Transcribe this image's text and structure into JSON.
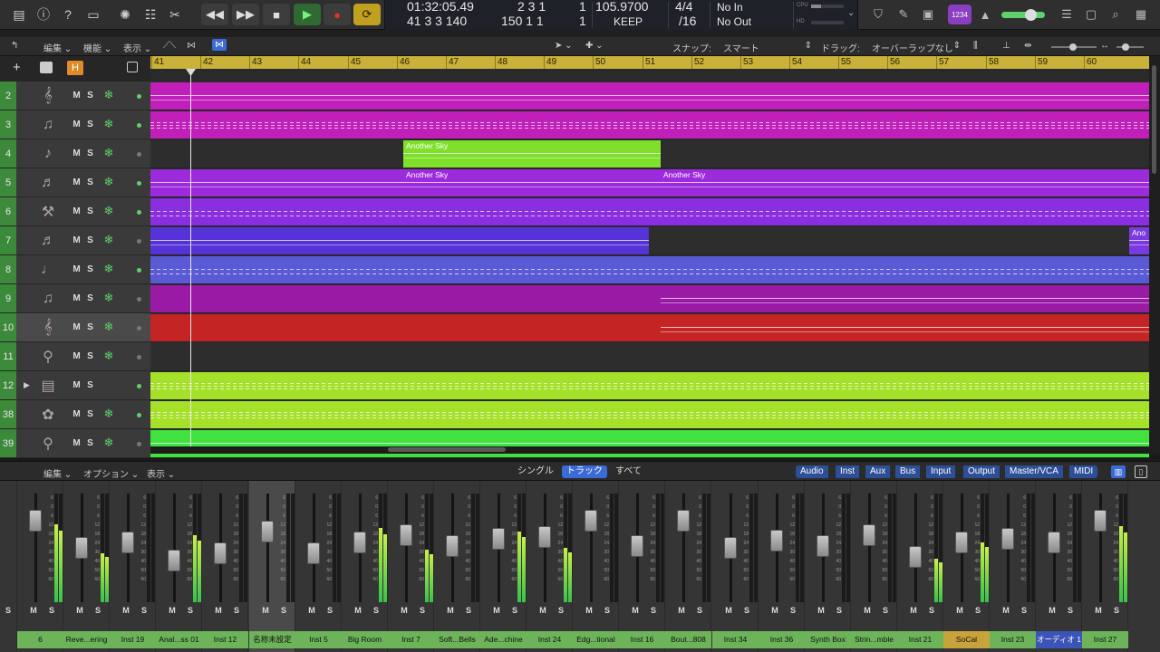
{
  "transport": {
    "time": "01:32:05.49",
    "beats": "2  3  1",
    "beats_tick": "1",
    "bars": "41  3  3  140",
    "bars2": "150  1  1",
    "bars2_tick": "1",
    "tempo": "105.9700",
    "tempo_mode": "KEEP",
    "sig": "4/4",
    "div": "/16",
    "in": "No In",
    "out": "No Out",
    "cpu_label": "CPU",
    "hd_label": "HD"
  },
  "tracks_menu": {
    "edit": "編集",
    "function": "機能",
    "view": "表示"
  },
  "snap": {
    "label": "スナップ:",
    "value": "スマート"
  },
  "drag": {
    "label": "ドラッグ:",
    "value": "オーバーラップなし"
  },
  "header": {
    "h": "H"
  },
  "ruler_bars": [
    "41",
    "42",
    "43",
    "44",
    "45",
    "46",
    "47",
    "48",
    "49",
    "50",
    "51",
    "52",
    "53",
    "54",
    "55",
    "56",
    "57",
    "58",
    "59",
    "60"
  ],
  "tracks": [
    {
      "num": "2",
      "icon": "violin-icon",
      "color": "#c01fba",
      "dot": "#5fd06a"
    },
    {
      "num": "3",
      "icon": "strings-icon",
      "color": "#c01fba",
      "dot": "#5fd06a"
    },
    {
      "num": "4",
      "icon": "horn-icon",
      "color": "#4a4a4a",
      "dot": "#777"
    },
    {
      "num": "5",
      "icon": "piano-icon",
      "color": "#9c2bdc",
      "dot": "#5fd06a"
    },
    {
      "num": "6",
      "icon": "mallet-icon",
      "color": "#8a2fe0",
      "dot": "#5fd06a"
    },
    {
      "num": "7",
      "icon": "piano-icon",
      "color": "#5533d6",
      "dot": "#777"
    },
    {
      "num": "8",
      "icon": "guitar-icon",
      "color": "#5a5ad6",
      "dot": "#5fd06a"
    },
    {
      "num": "9",
      "icon": "strings-icon",
      "color": "#9a1aa6",
      "dot": "#777"
    },
    {
      "num": "10",
      "icon": "violin-icon",
      "color": "#c42424",
      "dot": "#777"
    },
    {
      "num": "11",
      "icon": "drum-icon",
      "color": "#4a4a4a",
      "dot": "#777"
    },
    {
      "num": "12",
      "icon": "folder-icon",
      "color": "#a5e02a",
      "dot": "#5fd06a"
    },
    {
      "num": "38",
      "icon": "drum-kit-icon",
      "color": "#a5e02a",
      "dot": "#5fd06a"
    },
    {
      "num": "39",
      "icon": "drum-icon",
      "color": "#3fe23f",
      "dot": "#777"
    }
  ],
  "regions": {
    "r4": "Another Sky",
    "r5a": "Another Sky",
    "r5b": "Another Sky",
    "r7": "Ano"
  },
  "btn": {
    "m": "M",
    "s": "S"
  },
  "mixer_menu": {
    "edit": "編集",
    "options": "オプション",
    "view": "表示"
  },
  "mixer_modes": [
    "シングル",
    "トラック",
    "すべて"
  ],
  "mixer_filters": [
    "Audio",
    "Inst",
    "Aux",
    "Bus",
    "Input",
    "Output",
    "Master/VCA",
    "MIDI"
  ],
  "strips": [
    {
      "name": "6",
      "fader": 0.25,
      "meter": 0.72
    },
    {
      "name": "Reve...ering",
      "fader": 0.5,
      "meter": 0.45
    },
    {
      "name": "Inst 19",
      "fader": 0.45,
      "meter": 0.0
    },
    {
      "name": "Anal...ss 01",
      "fader": 0.62,
      "meter": 0.62
    },
    {
      "name": "Inst 12",
      "fader": 0.55,
      "meter": 0.0
    },
    {
      "name": "名称未設定",
      "fader": 0.35,
      "meter": 0.0
    },
    {
      "name": "Inst 5",
      "fader": 0.55,
      "meter": 0.0
    },
    {
      "name": "Big Room",
      "fader": 0.45,
      "meter": 0.68
    },
    {
      "name": "Inst 7",
      "fader": 0.38,
      "meter": 0.48
    },
    {
      "name": "Soft...Bells",
      "fader": 0.48,
      "meter": 0.0
    },
    {
      "name": "Ade...chine",
      "fader": 0.42,
      "meter": 0.65
    },
    {
      "name": "Inst 24",
      "fader": 0.4,
      "meter": 0.5
    },
    {
      "name": "Edg...tional",
      "fader": 0.25,
      "meter": 0.0
    },
    {
      "name": "Inst 16",
      "fader": 0.48,
      "meter": 0.0
    },
    {
      "name": "Bout...808",
      "fader": 0.25,
      "meter": 0.0
    },
    {
      "name": "Inst 34",
      "fader": 0.5,
      "meter": 0.0
    },
    {
      "name": "Inst 36",
      "fader": 0.43,
      "meter": 0.0
    },
    {
      "name": "Synth Box",
      "fader": 0.48,
      "meter": 0.0
    },
    {
      "name": "Strin...mble",
      "fader": 0.38,
      "meter": 0.0
    },
    {
      "name": "Inst 21",
      "fader": 0.58,
      "meter": 0.4
    },
    {
      "name": "SoCal",
      "fader": 0.45,
      "meter": 0.55
    },
    {
      "name": "Inst 23",
      "fader": 0.42,
      "meter": 0.0
    },
    {
      "name": "オーディオ 1",
      "fader": 0.45,
      "meter": 0.0
    },
    {
      "name": "Inst 27",
      "fader": 0.25,
      "meter": 0.7
    }
  ],
  "strip_colors": {
    "SoCal": "#c8a23a",
    "オーディオ 1": "#3a54b8"
  }
}
